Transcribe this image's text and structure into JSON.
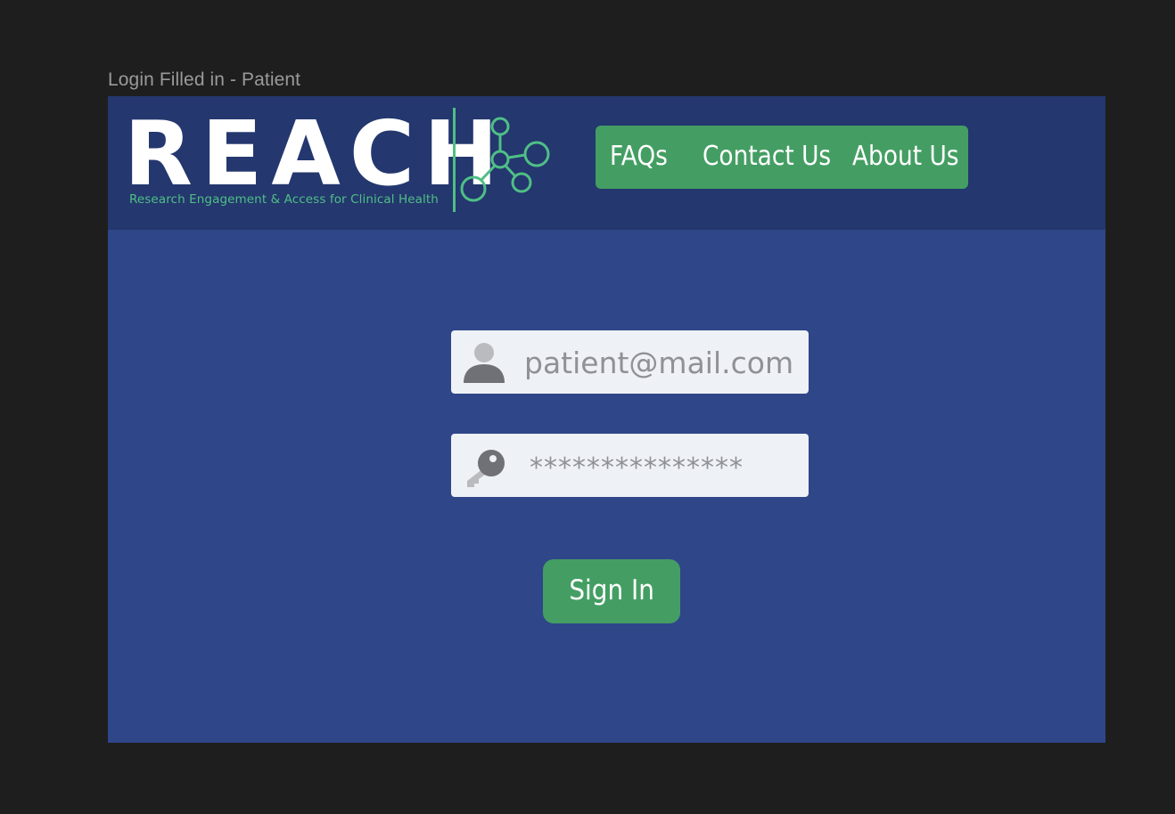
{
  "frame": {
    "label": "Login Filled in - Patient"
  },
  "header": {
    "logo_word": "REACH",
    "logo_tagline": "Research Engagement & Access for Clinical Health",
    "nav": [
      {
        "label": "FAQs"
      },
      {
        "label": "Contact Us"
      },
      {
        "label": "About Us"
      }
    ]
  },
  "login": {
    "email_value": "patient@mail.com",
    "password_value": "***************",
    "submit_label": "Sign In"
  },
  "icons": {
    "email": "user-icon",
    "password": "key-icon",
    "logo": "network-icon"
  },
  "colors": {
    "background": "#2f4689",
    "header": "#24376e",
    "accent": "#449e63",
    "logo_green": "#4fbf86",
    "field_bg": "#eef1f6"
  }
}
